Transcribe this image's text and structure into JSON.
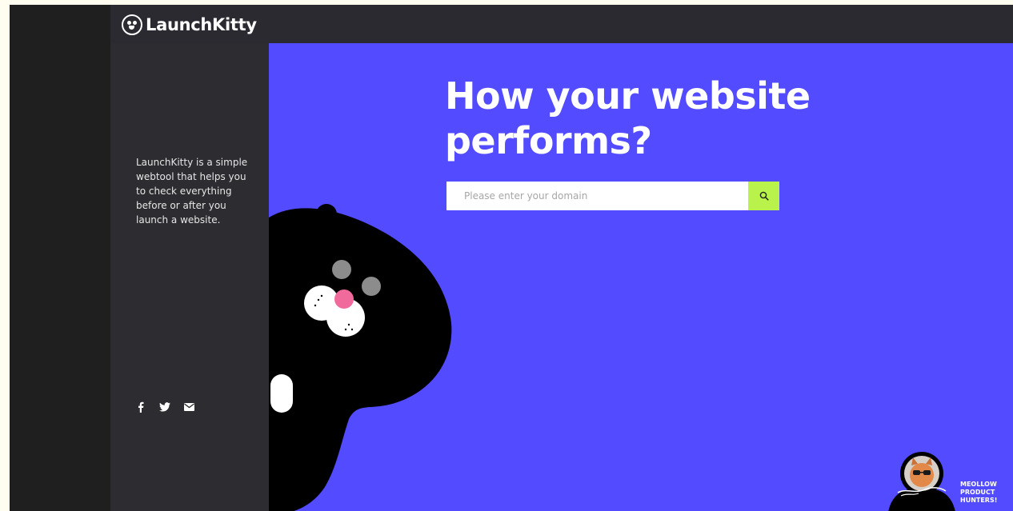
{
  "brand": {
    "name": "LaunchKitty"
  },
  "sidebar": {
    "description": "LaunchKitty is a simple webtool that helps you to check everything before or after you launch a website.",
    "social": [
      {
        "icon": "facebook-icon"
      },
      {
        "icon": "twitter-icon"
      },
      {
        "icon": "mail-icon"
      }
    ]
  },
  "hero": {
    "headline_line1": "How your website",
    "headline_line2": "performs?"
  },
  "search": {
    "placeholder": "Please enter your domain",
    "button_icon": "search-icon"
  },
  "badge": {
    "line1": "MEOLLOW",
    "line2": "PRODUCT",
    "line3": "HUNTERS!"
  },
  "colors": {
    "hero_bg": "#524bff",
    "search_button": "#b8f24a",
    "sidebar_bg": "#2d2d31",
    "topbar_bg": "#2a2a30",
    "cat_nose": "#f06a9c"
  }
}
